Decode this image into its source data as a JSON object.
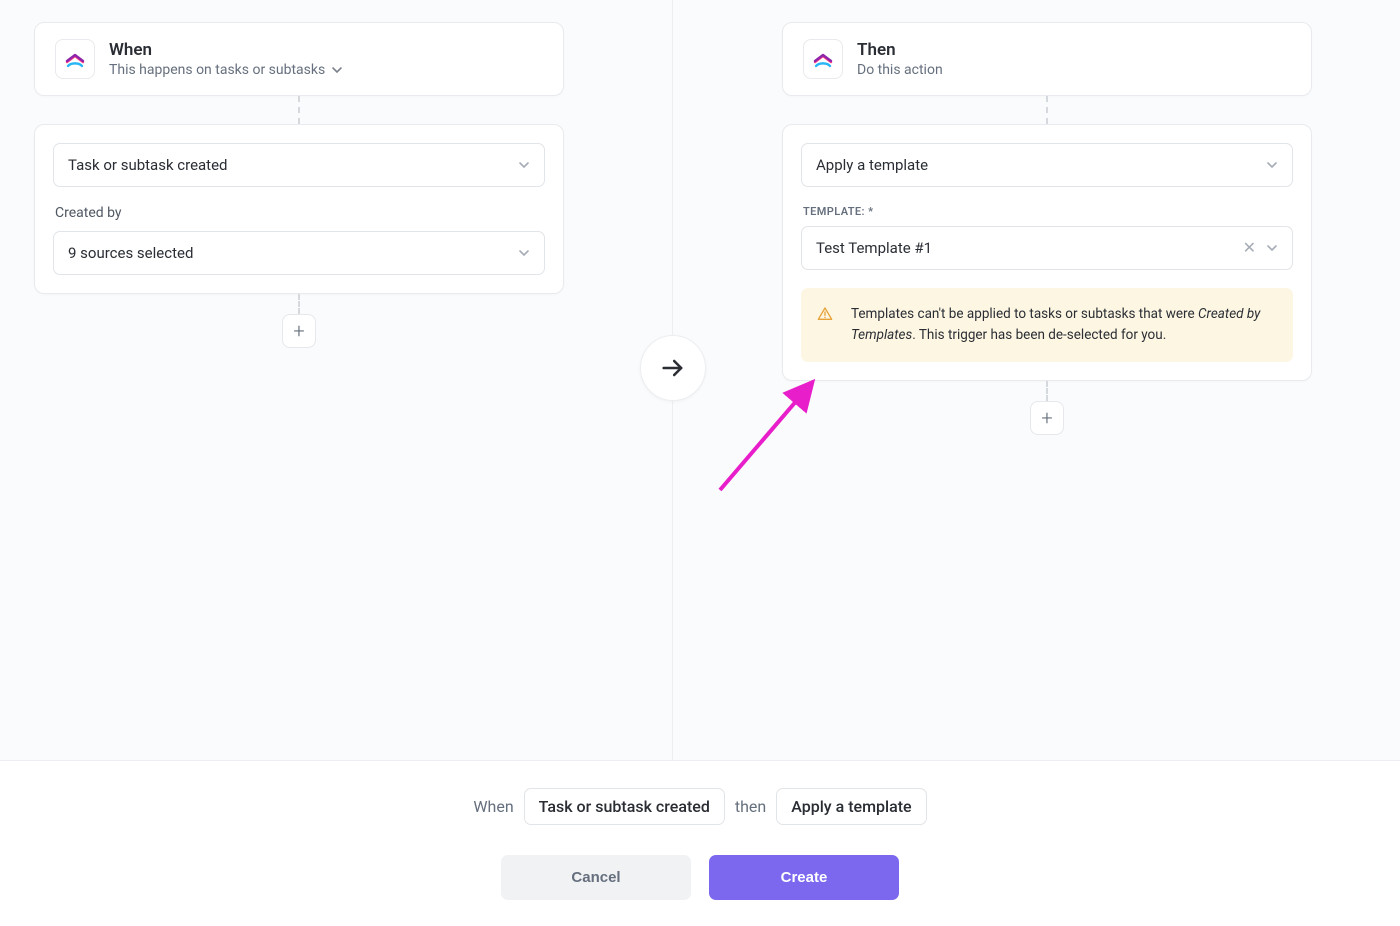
{
  "when": {
    "title": "When",
    "subtitle": "This happens on tasks or subtasks",
    "triggerSelect": "Task or subtask created",
    "createdByLabel": "Created by",
    "sourcesSelect": "9 sources selected"
  },
  "then": {
    "title": "Then",
    "subtitle": "Do this action",
    "actionSelect": "Apply a template",
    "templateLabel": "TEMPLATE: *",
    "templateValue": "Test Template #1",
    "warningPart1": "Templates can't be applied to tasks or subtasks that were ",
    "warningItalic": "Created by Templates",
    "warningPart2": ". This trigger has been de-selected for you."
  },
  "footer": {
    "whenText": "When",
    "triggerPill": "Task or subtask created",
    "thenText": "then",
    "actionPill": "Apply a template",
    "cancelLabel": "Cancel",
    "createLabel": "Create"
  }
}
